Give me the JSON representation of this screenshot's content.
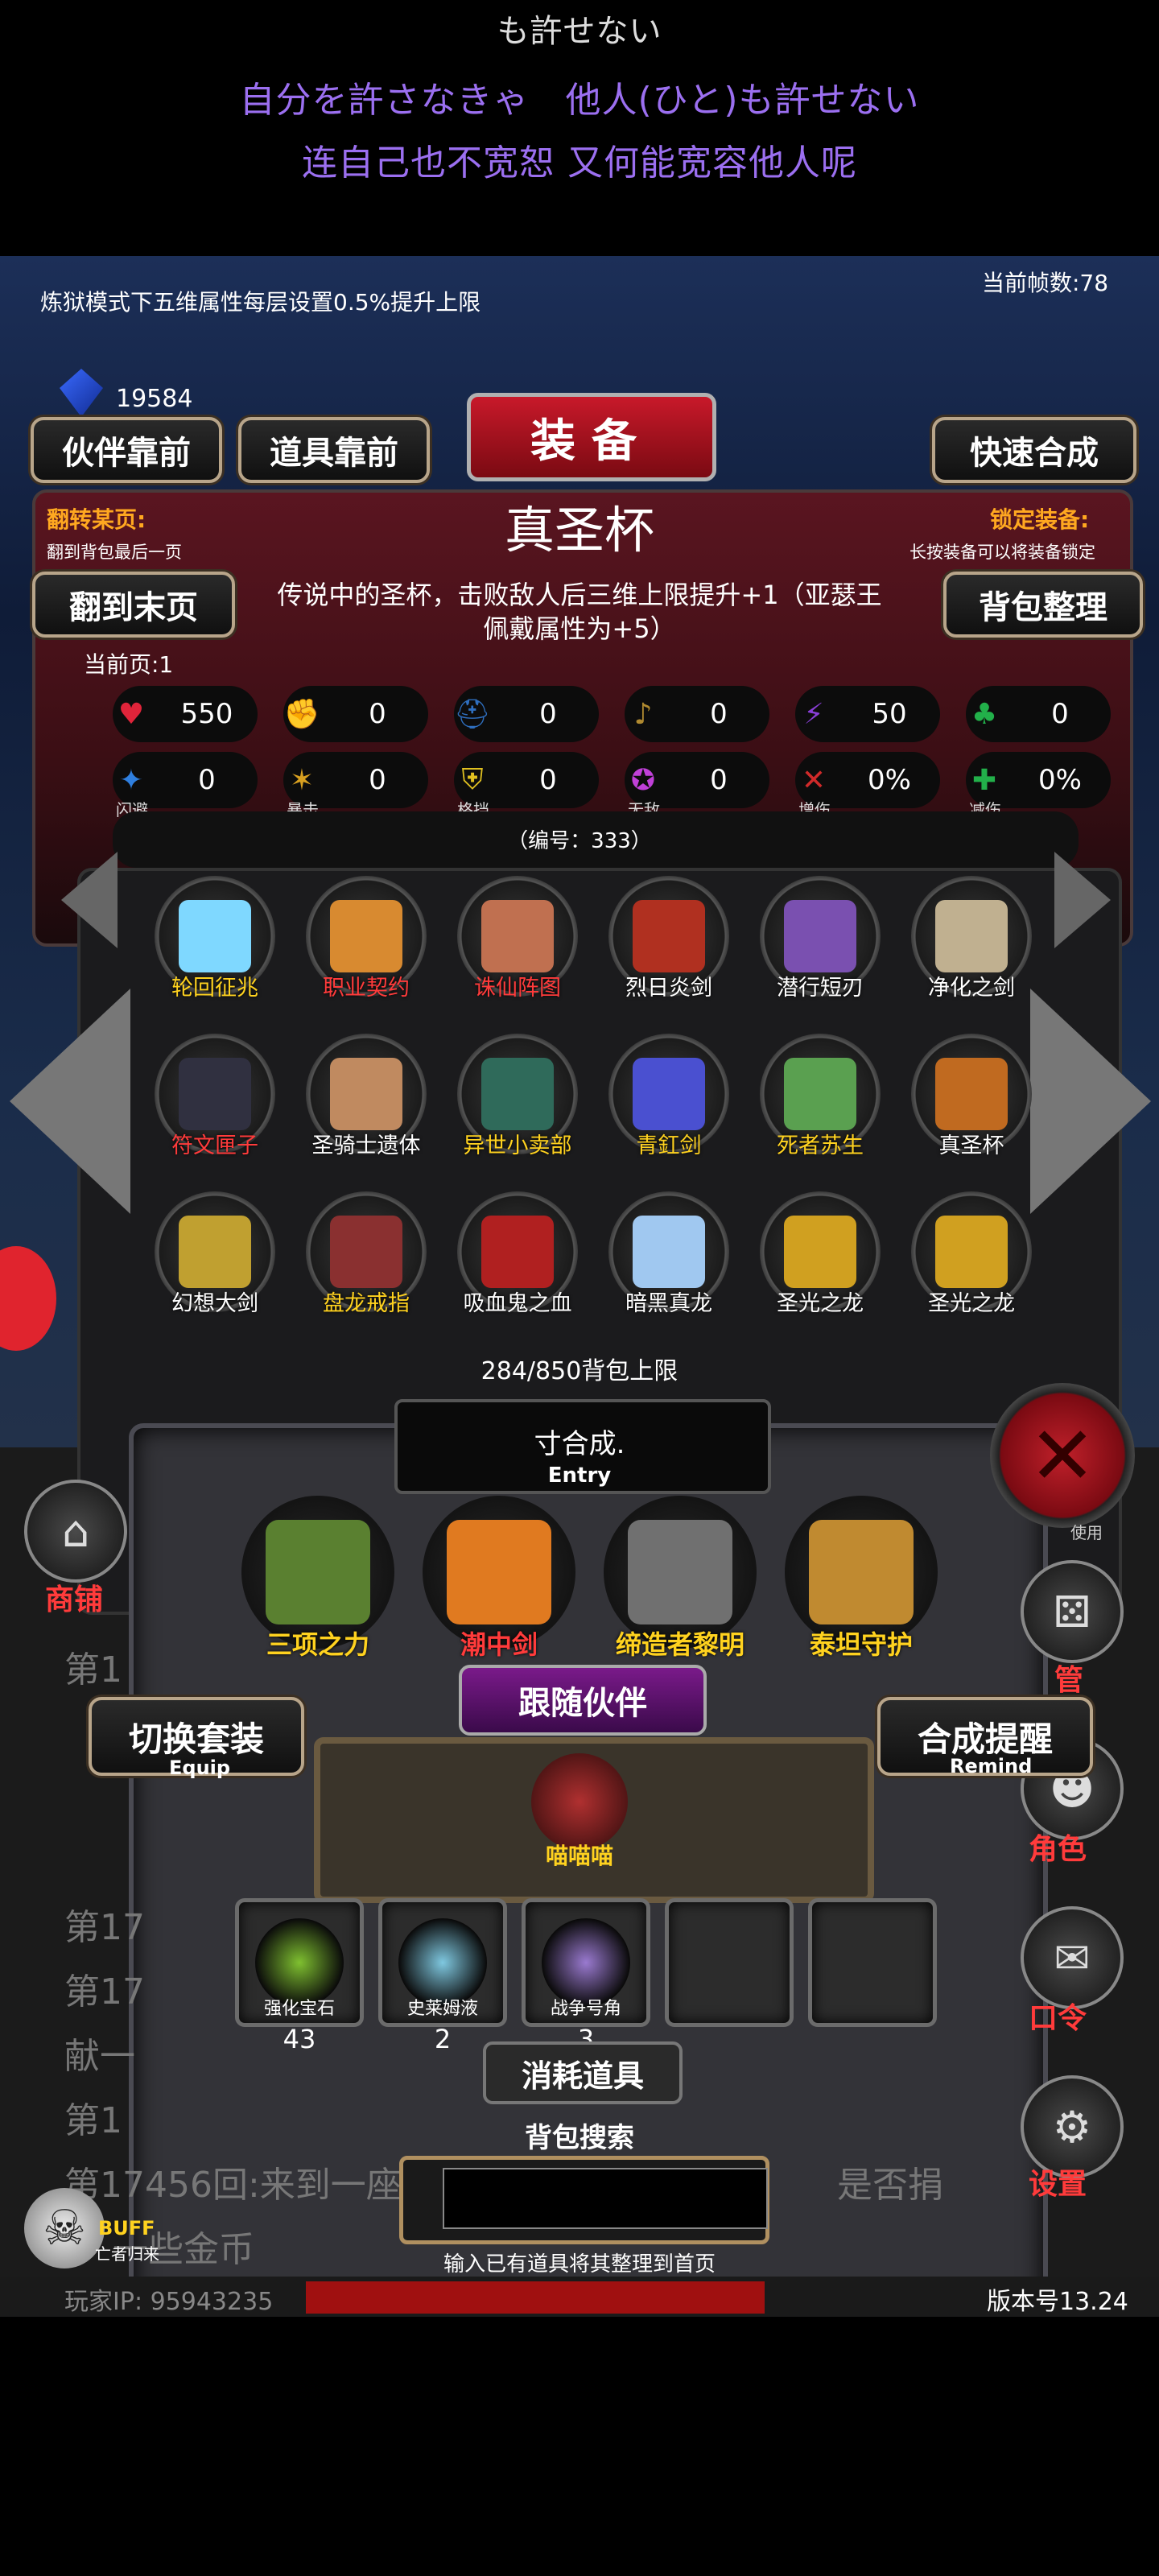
{
  "lyrics": {
    "line0": "も許せない",
    "line1": "自分を許さなきゃ　他人(ひと)も許せない",
    "line2": "连自己也不宽恕 又何能宽容他人呢"
  },
  "header": {
    "notice": "炼狱模式下五维属性每层设置0.5%提升上限",
    "fps": "当前帧数:78",
    "gems": "19584",
    "title": "装备"
  },
  "buttons": {
    "partner_first": "伙伴靠前",
    "items_first": "道具靠前",
    "quick_merge": "快速合成",
    "to_last_page": "翻到末页",
    "bag_sort": "背包整理",
    "switch_set": "切换套装",
    "switch_set_sub": "Equip",
    "merge_remind": "合成提醒",
    "merge_remind_sub": "Remind",
    "follow_partner": "跟随伙伴",
    "consumables": "消耗道具",
    "bag_search": "背包搜索"
  },
  "page_info": {
    "jump_label": "翻转某页:",
    "jump_hint": "翻到背包最后一页",
    "lock_label": "锁定装备:",
    "lock_hint": "长按装备可以将装备锁定",
    "current_page": "当前页:1"
  },
  "item_detail": {
    "name": "真圣杯",
    "description": "传说中的圣杯，击败敌人后三维上限提升+1（亚瑟王佩戴属性为+5）",
    "id_text": "（编号：333）"
  },
  "stats_row1": [
    {
      "icon": "heart-icon",
      "value": "550",
      "color": "#e0243a",
      "glyph": "♥"
    },
    {
      "icon": "strength-icon",
      "value": "0",
      "color": "#d8b020",
      "glyph": "✊"
    },
    {
      "icon": "helmet-icon",
      "value": "0",
      "color": "#2f6fbf",
      "glyph": "⛑"
    },
    {
      "icon": "lute-icon",
      "value": "0",
      "color": "#b08a30",
      "glyph": "♪"
    },
    {
      "icon": "lightning-icon",
      "value": "50",
      "color": "#8a3fd8",
      "glyph": "⚡"
    },
    {
      "icon": "clover-icon",
      "value": "0",
      "color": "#22b04a",
      "glyph": "♣"
    }
  ],
  "stats_row2": [
    {
      "icon": "dodge-icon",
      "value": "0",
      "caption": "闪避",
      "color": "#2f7fdf",
      "glyph": "✦"
    },
    {
      "icon": "crit-icon",
      "value": "0",
      "caption": "暴击",
      "color": "#d8a020",
      "glyph": "✶"
    },
    {
      "icon": "block-icon",
      "value": "0",
      "caption": "格挡",
      "color": "#e0c020",
      "glyph": "⛨"
    },
    {
      "icon": "invincible-icon",
      "value": "0",
      "caption": "无敌",
      "color": "#c040d8",
      "glyph": "✪"
    },
    {
      "icon": "damage-up-icon",
      "value": "0%",
      "caption": "增伤",
      "color": "#d02a2a",
      "glyph": "✕"
    },
    {
      "icon": "damage-down-icon",
      "value": "0%",
      "caption": "减伤",
      "color": "#22b04a",
      "glyph": "✚"
    }
  ],
  "inventory": [
    {
      "label": "轮回征兆",
      "color": "yellow",
      "art": "#7fd8ff"
    },
    {
      "label": "职业契约",
      "color": "red",
      "art": "#d88a30"
    },
    {
      "label": "诛仙阵图",
      "color": "red",
      "art": "#c07050"
    },
    {
      "label": "烈日炎剑",
      "color": "white",
      "art": "#b03020"
    },
    {
      "label": "潜行短刃",
      "color": "white",
      "art": "#7a50b0"
    },
    {
      "label": "净化之剑",
      "color": "white",
      "art": "#c0b090"
    },
    {
      "label": "符文匣子",
      "color": "red",
      "art": "#303040"
    },
    {
      "label": "圣骑士遗体",
      "color": "white",
      "art": "#c08a60"
    },
    {
      "label": "异世小卖部",
      "color": "yellow",
      "art": "#2f6a5a"
    },
    {
      "label": "青釭剑",
      "color": "yellow",
      "art": "#4a50d0"
    },
    {
      "label": "死者苏生",
      "color": "yellow",
      "art": "#5aa050"
    },
    {
      "label": "真圣杯",
      "color": "white",
      "art": "#c06a20"
    },
    {
      "label": "幻想大剑",
      "color": "white",
      "art": "#c0a030"
    },
    {
      "label": "盘龙戒指",
      "color": "yellow",
      "art": "#8a3030"
    },
    {
      "label": "吸血鬼之血",
      "color": "white",
      "art": "#b02020"
    },
    {
      "label": "暗黑真龙",
      "color": "white",
      "art": "#a0c8f0"
    },
    {
      "label": "圣光之龙",
      "color": "white",
      "art": "#d0a020"
    },
    {
      "label": "圣光之龙",
      "color": "white",
      "art": "#d0a020"
    }
  ],
  "bag_capacity": "284/850背包上限",
  "entry": {
    "text": "寸合成.",
    "sub": "Entry"
  },
  "equipped": [
    {
      "label": "三项之力",
      "color": "#ffd21f",
      "art": "#5a8030"
    },
    {
      "label": "潮中剑",
      "color": "#ff3b3b",
      "art": "#e07a20"
    },
    {
      "label": "缔造者黎明",
      "color": "#ffd21f",
      "art": "#707070"
    },
    {
      "label": "泰坦守护",
      "color": "#ffd21f",
      "art": "#c08a30"
    }
  ],
  "partner": {
    "label": "喵喵喵"
  },
  "consumable_items": [
    {
      "label": "强化宝石",
      "count": "43",
      "art": "#7fc030"
    },
    {
      "label": "史莱姆液",
      "count": "2",
      "art": "#7fc8e0"
    },
    {
      "label": "战争号角",
      "count": "3",
      "art": "#9a7ad0"
    },
    {
      "label": "",
      "count": "",
      "art": ""
    },
    {
      "label": "",
      "count": "",
      "art": ""
    }
  ],
  "search": {
    "placeholder": "",
    "hint": "输入已有道具将其整理到首页"
  },
  "side_menu": {
    "shop": "商铺",
    "manage": "管",
    "role": "角色",
    "command": "口令",
    "settings": "设置",
    "use_hint": "使用"
  },
  "log": {
    "line1": "第1",
    "line2": "第17",
    "line3": "第17",
    "line4": "献一",
    "line5": "第1",
    "line6": "第17456回:来到一座",
    "line6b": "是否捐",
    "line7": "一些金币"
  },
  "buff": {
    "label": "BUFF",
    "sub": "亡者归来"
  },
  "footer": {
    "player_ip": "玩家IP: 95943235",
    "version": "版本号13.24"
  }
}
